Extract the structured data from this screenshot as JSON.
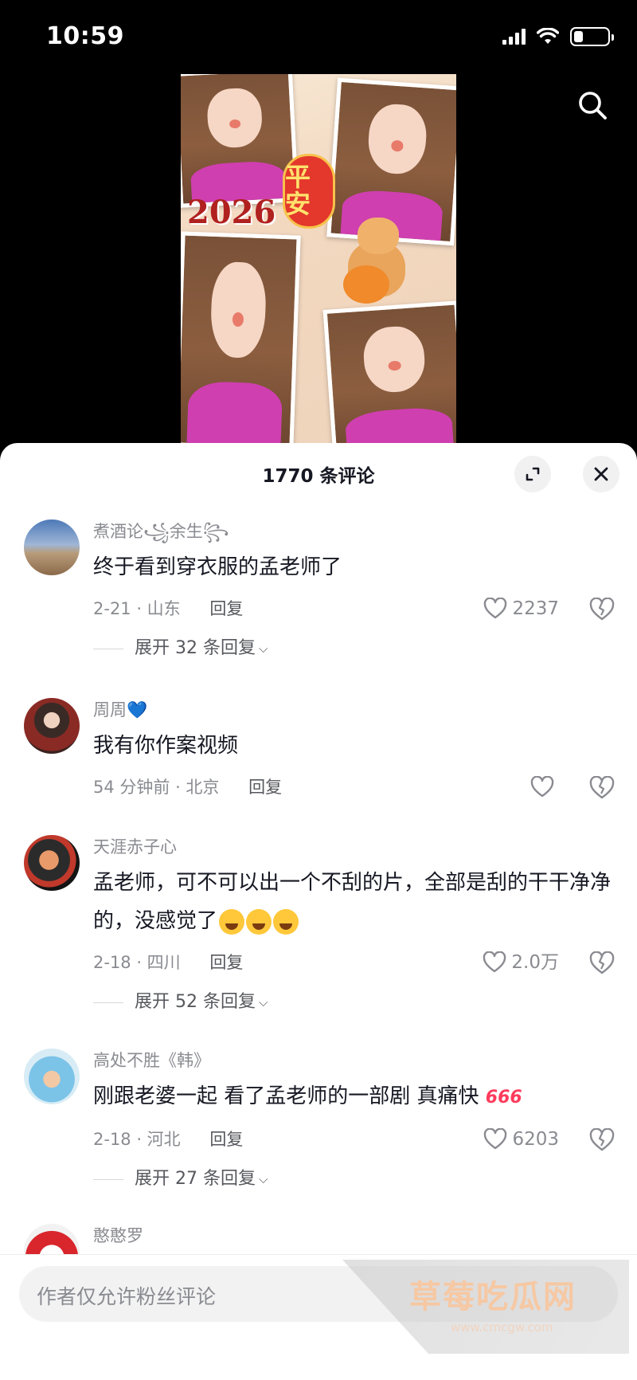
{
  "status_bar": {
    "time": "10:59"
  },
  "video": {
    "overlay_text": "平安",
    "year_text": "2026"
  },
  "comments_panel": {
    "title": "1770 条评论",
    "comments": [
      {
        "username": "煮酒论꧁余生꧂",
        "text": "终于看到穿衣服的孟老师了",
        "time": "2-21 · 山东",
        "reply": "回复",
        "likes": "2237",
        "expand": "展开 32 条回复"
      },
      {
        "username": "周周💙",
        "text": "我有你作案视频",
        "time": "54 分钟前 · 北京",
        "reply": "回复",
        "likes": ""
      },
      {
        "username": "天涯赤子心",
        "text": "孟老师，可不可以出一个不刮的片，全部是刮的干干净净的，没感觉了",
        "time": "2-18 · 四川",
        "reply": "回复",
        "likes": "2.0万",
        "expand": "展开 52 条回复"
      },
      {
        "username": "高处不胜《韩》",
        "text": "刚跟老婆一起 看了孟老师的一部剧 真痛快",
        "tag": "666",
        "time": "2-18 · 河北",
        "reply": "回复",
        "likes": "6203",
        "expand": "展开 27 条回复"
      },
      {
        "username": "憨憨罗"
      }
    ]
  },
  "input": {
    "placeholder": "作者仅允许粉丝评论"
  },
  "watermark": {
    "title": "草莓吃瓜网",
    "url": "www.cmcgw.com"
  }
}
